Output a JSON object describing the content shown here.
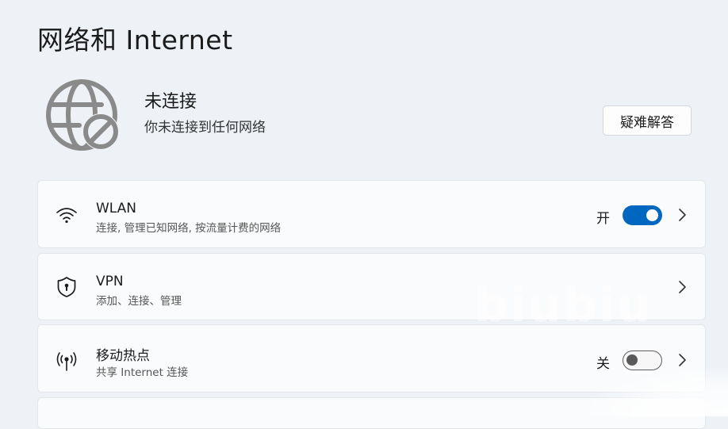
{
  "page": {
    "title": "网络和 Internet"
  },
  "status": {
    "title": "未连接",
    "subtitle": "你未连接到任何网络",
    "icon": "globe-disconnected-icon",
    "troubleshoot_label": "疑难解答"
  },
  "items": [
    {
      "title": "WLAN",
      "description": "连接, 管理已知网络, 按流量计费的网络",
      "icon": "wifi-icon",
      "state_label": "开",
      "toggle": true
    },
    {
      "title": "VPN",
      "description": "添加、连接、管理",
      "icon": "shield-icon"
    },
    {
      "title": "移动热点",
      "description": "共享 Internet 连接",
      "icon": "hotspot-icon",
      "state_label": "关",
      "toggle": false
    }
  ],
  "watermark": "biubiu",
  "colors": {
    "accent": "#0067c0",
    "background": "#eef2f7",
    "card": "#fafbfc"
  }
}
